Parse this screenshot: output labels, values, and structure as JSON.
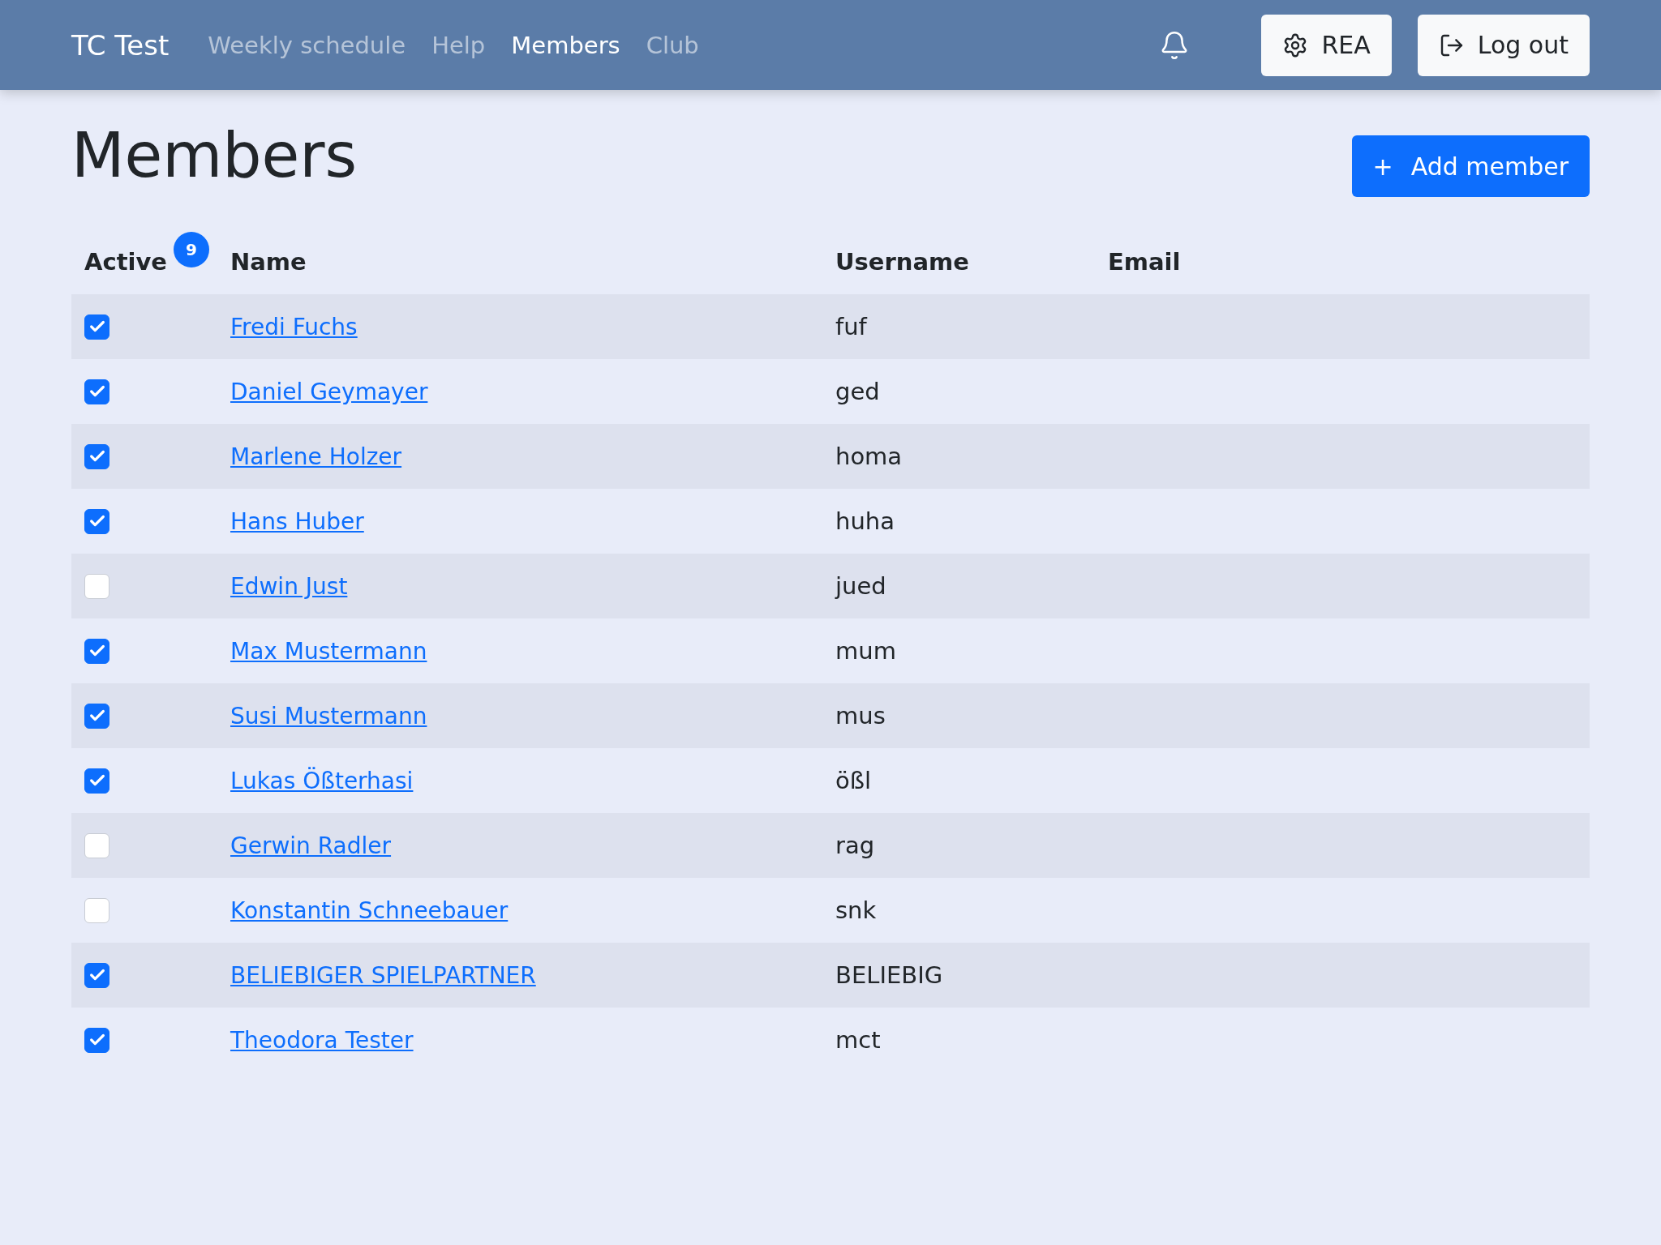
{
  "navbar": {
    "brand": "TC Test",
    "links": [
      {
        "label": "Weekly schedule",
        "selected": false
      },
      {
        "label": "Help",
        "selected": false
      },
      {
        "label": "Members",
        "selected": true
      },
      {
        "label": "Club",
        "selected": false
      }
    ],
    "settings_button": "REA",
    "logout_button": "Log out"
  },
  "page": {
    "title": "Members",
    "add_button": "Add member",
    "add_icon": "+"
  },
  "table": {
    "columns": [
      "Active",
      "Name",
      "Username",
      "Email"
    ],
    "active_count": "9",
    "rows": [
      {
        "active": true,
        "name": "Fredi Fuchs",
        "username": "fuf"
      },
      {
        "active": true,
        "name": "Daniel Geymayer",
        "username": "ged"
      },
      {
        "active": true,
        "name": "Marlene Holzer",
        "username": "homa"
      },
      {
        "active": true,
        "name": "Hans Huber",
        "username": "huha"
      },
      {
        "active": false,
        "name": "Edwin Just",
        "username": "jued"
      },
      {
        "active": true,
        "name": "Max Mustermann",
        "username": "mum"
      },
      {
        "active": true,
        "name": "Susi Mustermann",
        "username": "mus"
      },
      {
        "active": true,
        "name": "Lukas Ößterhasi",
        "username": "ößl"
      },
      {
        "active": false,
        "name": "Gerwin Radler",
        "username": "rag"
      },
      {
        "active": false,
        "name": "Konstantin Schneebauer",
        "username": "snk"
      },
      {
        "active": true,
        "name": "BELIEBIGER SPIELPARTNER",
        "username": "BELIEBIG"
      },
      {
        "active": true,
        "name": "Theodora Tester",
        "username": "mct"
      }
    ]
  }
}
